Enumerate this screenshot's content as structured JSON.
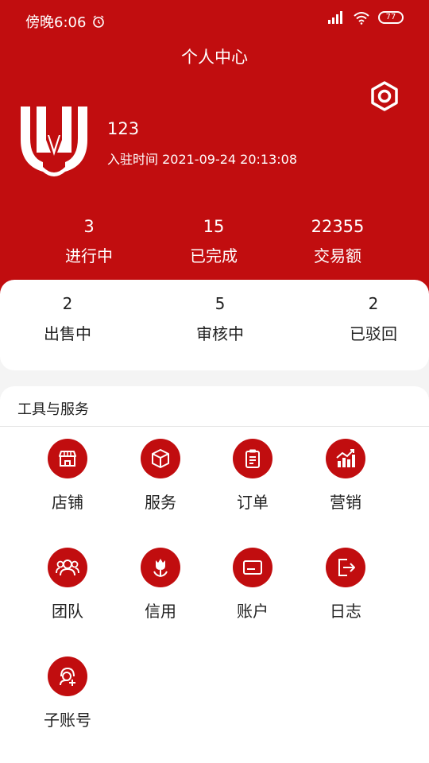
{
  "status_bar": {
    "time": "傍晚6:06",
    "battery": "77"
  },
  "header": {
    "title": "个人中心"
  },
  "profile": {
    "name": "123",
    "join_time": "入驻时间 2021-09-24 20:13:08"
  },
  "stats": [
    {
      "value": "3",
      "label": "进行中"
    },
    {
      "value": "15",
      "label": "已完成"
    },
    {
      "value": "22355",
      "label": "交易额"
    }
  ],
  "listing_stats": [
    {
      "value": "2",
      "label": "出售中"
    },
    {
      "value": "5",
      "label": "审核中"
    },
    {
      "value": "2",
      "label": "已驳回"
    }
  ],
  "tools": {
    "title": "工具与服务",
    "items": [
      {
        "label": "店铺",
        "icon": "store-icon"
      },
      {
        "label": "服务",
        "icon": "box-icon"
      },
      {
        "label": "订单",
        "icon": "clipboard-icon"
      },
      {
        "label": "营销",
        "icon": "chart-icon"
      },
      {
        "label": "团队",
        "icon": "team-icon"
      },
      {
        "label": "信用",
        "icon": "tulip-icon"
      },
      {
        "label": "账户",
        "icon": "card-icon"
      },
      {
        "label": "日志",
        "icon": "logout-icon"
      },
      {
        "label": "子账号",
        "icon": "add-user-icon"
      }
    ]
  },
  "colors": {
    "brand": "#c10d0f"
  }
}
